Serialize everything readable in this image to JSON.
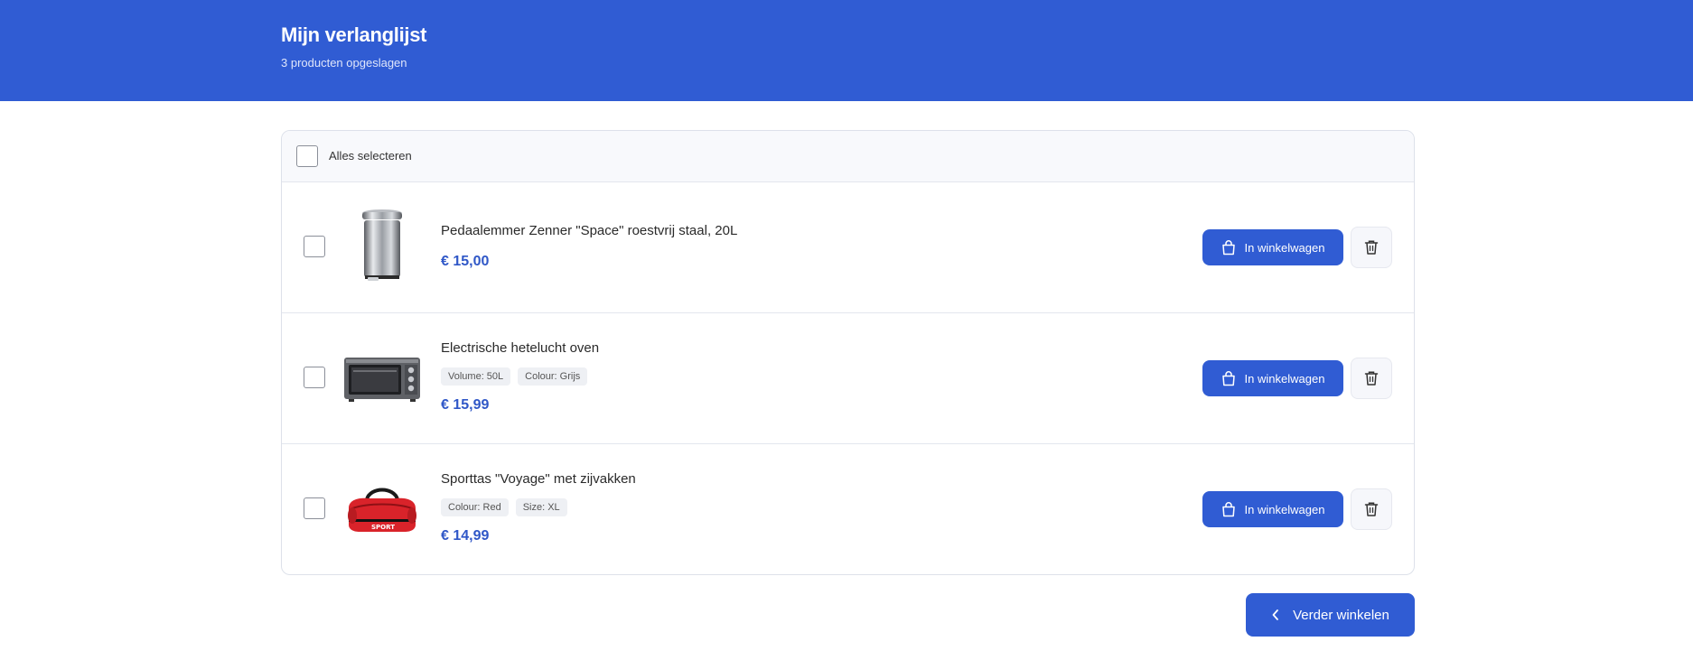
{
  "header": {
    "title": "Mijn verlanglijst",
    "subtitle": "3 producten opgeslagen"
  },
  "list": {
    "select_all_label": "Alles selecteren",
    "items": [
      {
        "name": "Pedaalemmer Zenner \"Space\" roestvrij staal, 20L",
        "price": "€ 15,00",
        "tags": [],
        "cart_label": "In winkelwagen",
        "image": "pedal-bin-image"
      },
      {
        "name": "Electrische hetelucht oven",
        "price": "€ 15,99",
        "tags": [
          "Volume: 50L",
          "Colour: Grijs"
        ],
        "cart_label": "In winkelwagen",
        "image": "oven-image"
      },
      {
        "name": "Sporttas \"Voyage\" met zijvakken",
        "price": "€ 14,99",
        "tags": [
          "Colour: Red",
          "Size: XL"
        ],
        "cart_label": "In winkelwagen",
        "image": "sports-bag-image",
        "image_text": "SPORT"
      }
    ]
  },
  "footer": {
    "continue_label": "Verder winkelen"
  },
  "icons": {
    "cart": "shopping-bag-icon",
    "delete": "trash-icon",
    "back": "chevron-left-icon"
  },
  "colors": {
    "brand": "#305cd3",
    "price": "#2f57c7"
  }
}
